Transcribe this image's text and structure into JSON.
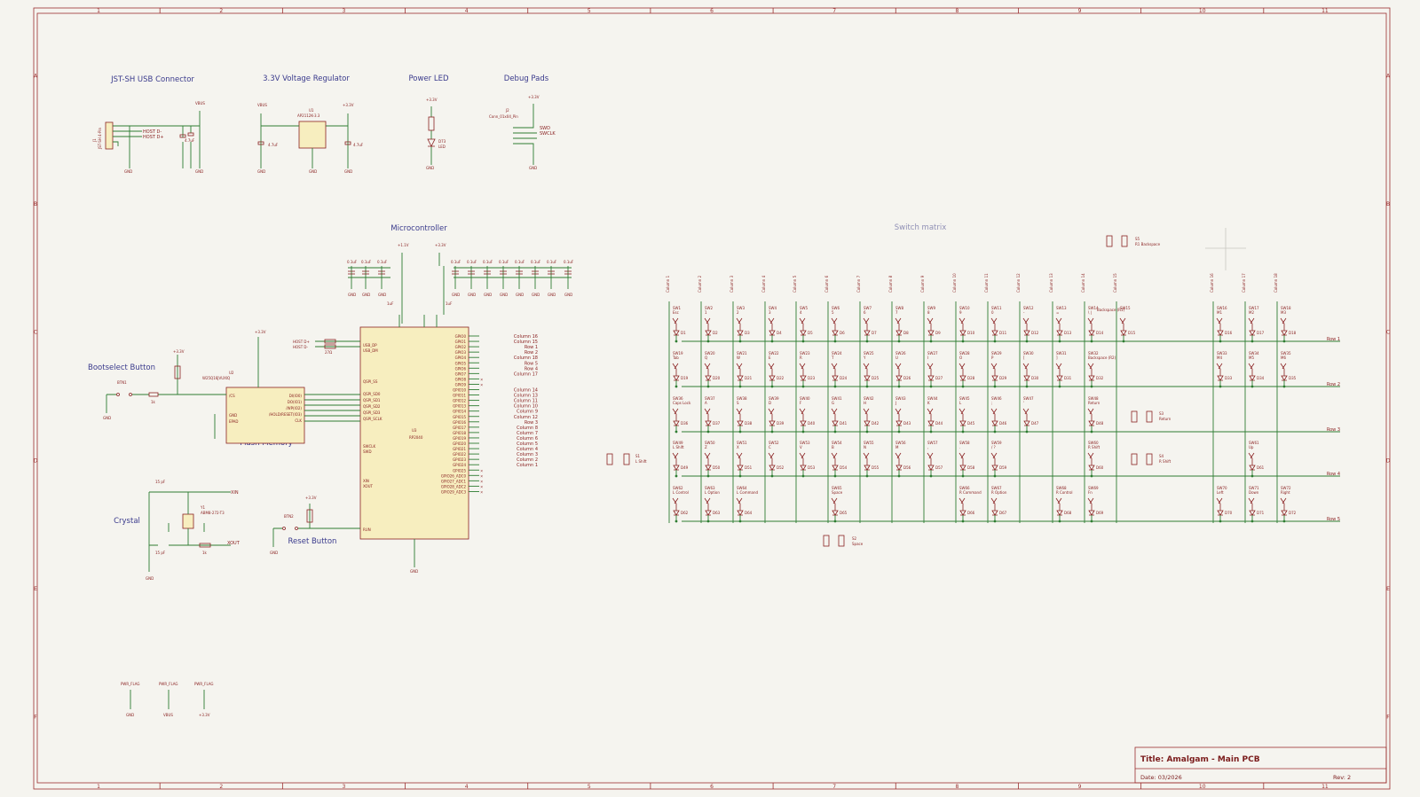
{
  "frame": {
    "columns": [
      "1",
      "2",
      "3",
      "4",
      "5",
      "6",
      "7",
      "8",
      "9",
      "10",
      "11"
    ],
    "rows": [
      "A",
      "B",
      "C",
      "D",
      "E",
      "F"
    ]
  },
  "sections": {
    "usb": "JST-SH USB Connector",
    "regulator": "3.3V Voltage Regulator",
    "power_led": "Power LED",
    "debug": "Debug Pads",
    "mcu": "Microcontroller",
    "matrix": "Switch matrix",
    "bootsel": "Bootselect Button",
    "flash": "Flash Memory",
    "crystal": "Crystal",
    "reset": "Reset Button"
  },
  "nets": {
    "gnd": "GND",
    "vbus": "VBUS",
    "v33": "+3.3V",
    "v11": "+1.1V",
    "host_dm": "HOST D-",
    "host_dp": "HOST D+",
    "swd": "SWD",
    "swclk": "SWCLK",
    "xin": "XIN",
    "xout": "XOUT",
    "pwr_flag": "PWR_FLAG"
  },
  "parts": {
    "j1": "J1",
    "j1_val": "JST-SH 4-Pin",
    "u1": "U1",
    "u1_val": "AP2112K-3.3",
    "j2": "J2",
    "j2_val": "Conn_01x04_Pin",
    "d73": "D73",
    "led": "LED",
    "u2": "U2",
    "u2_val": "W25Q16JVUXIQ",
    "u3": "U3",
    "u3_val": "RP2040",
    "btn1": "BTN1",
    "btn2": "BTN2",
    "y1": "Y1",
    "y1_val": "ABM8-272-T3",
    "r_1k": "1k",
    "r_27": "27Ω",
    "r_10k": "10k",
    "c_1u": "1uF",
    "c_47u": "4.7uF",
    "c_01u": "0.1uF",
    "c_15p": "15 pF"
  },
  "rp2040_pins_left": [
    "USB_DP",
    "USB_DM",
    "QSPI_SS",
    "QSPI_SD0",
    "QSPI_SD1",
    "QSPI_SD2",
    "QSPI_SD3",
    "QSPI_SCLK",
    "SWCLK",
    "SWD",
    "XIN",
    "XOUT",
    "RUN"
  ],
  "rp2040_gpio": [
    "GPIO0",
    "GPIO1",
    "GPIO2",
    "GPIO3",
    "GPIO4",
    "GPIO5",
    "GPIO6",
    "GPIO7",
    "GPIO8",
    "GPIO9",
    "GPIO10",
    "GPIO11",
    "GPIO12",
    "GPIO13",
    "GPIO14",
    "GPIO15",
    "GPIO16",
    "GPIO17",
    "GPIO18",
    "GPIO19",
    "GPIO20",
    "GPIO21",
    "GPIO22",
    "GPIO23",
    "GPIO24",
    "GPIO25",
    "GPIO26_ADC0",
    "GPIO27_ADC1",
    "GPIO28_ADC2",
    "GPIO29_ADC3"
  ],
  "rp2040_gpio_nets": [
    "Column 16",
    "Column 15",
    "Row 1",
    "Row 2",
    "Column 18",
    "Row 5",
    "Row 4",
    "Column 17",
    "",
    "",
    "Column 14",
    "Column 13",
    "Column 11",
    "Column 10",
    "Column 9",
    "Column 12",
    "Row 3",
    "Column 8",
    "Column 7",
    "Column 6",
    "Column 5",
    "Column 4",
    "Column 3",
    "Column 2",
    "Column 1",
    "",
    "",
    "",
    "",
    ""
  ],
  "flash_pins": [
    "/CS",
    "DI(IO0)",
    "DO(IO1)",
    "/WP(IO2)",
    "/HOLD/RESET(IO3)",
    "CLK",
    "GND",
    "EPAD"
  ],
  "matrix": {
    "columns": [
      "Column 1",
      "Column 2",
      "Column 3",
      "Column 4",
      "Column 5",
      "Column 6",
      "Column 7",
      "Column 8",
      "Column 9",
      "Column 10",
      "Column 11",
      "Column 12",
      "Column 13",
      "Column 14",
      "Column 15",
      "Column 16",
      "Column 17",
      "Column 18"
    ],
    "rows": [
      "Row 1",
      "Row 2",
      "Row 3",
      "Row 4",
      "Row 5"
    ],
    "row1_keys": [
      "Esc",
      "1",
      "2",
      "3",
      "4",
      "5",
      "6",
      "7",
      "8",
      "9",
      "0",
      "-",
      "=",
      "\\ |",
      "`",
      "M1",
      "M2",
      "M3"
    ],
    "row2_keys": [
      "Tab",
      "Q",
      "W",
      "E",
      "R",
      "T",
      "Y",
      "U",
      "I",
      "O",
      "P",
      "[",
      "]",
      "Backspace (R2)",
      "M4",
      "M5",
      "M6"
    ],
    "row3_keys": [
      "Caps Lock",
      "A",
      "S",
      "D",
      "F",
      "G",
      "H",
      "J",
      "K",
      "L",
      ";",
      "'",
      "Return"
    ],
    "row4_keys": [
      "L Shift",
      "Z",
      "X",
      "C",
      "V",
      "B",
      "N",
      "M",
      ",",
      ".",
      "/ ?",
      "R Shift",
      "Up"
    ],
    "row5_keys": [
      "L Control",
      "L Option",
      "L Command",
      "Space",
      "R Command",
      "R Option",
      "R Control",
      "Fn",
      "Left",
      "Down",
      "Right"
    ],
    "stabs": [
      {
        "ref": "S1",
        "label": "L Shift"
      },
      {
        "ref": "S2",
        "label": "Space"
      },
      {
        "ref": "S3",
        "label": "Return"
      },
      {
        "ref": "S4",
        "label": "R Shift"
      },
      {
        "ref": "S5",
        "label": "R1 Backspace"
      }
    ],
    "extra_key": "Backspace (R1)"
  },
  "title_block": {
    "title": "Title: Amalgam - Main PCB",
    "date": "Date: 03/2026",
    "rev": "Rev: 2"
  }
}
